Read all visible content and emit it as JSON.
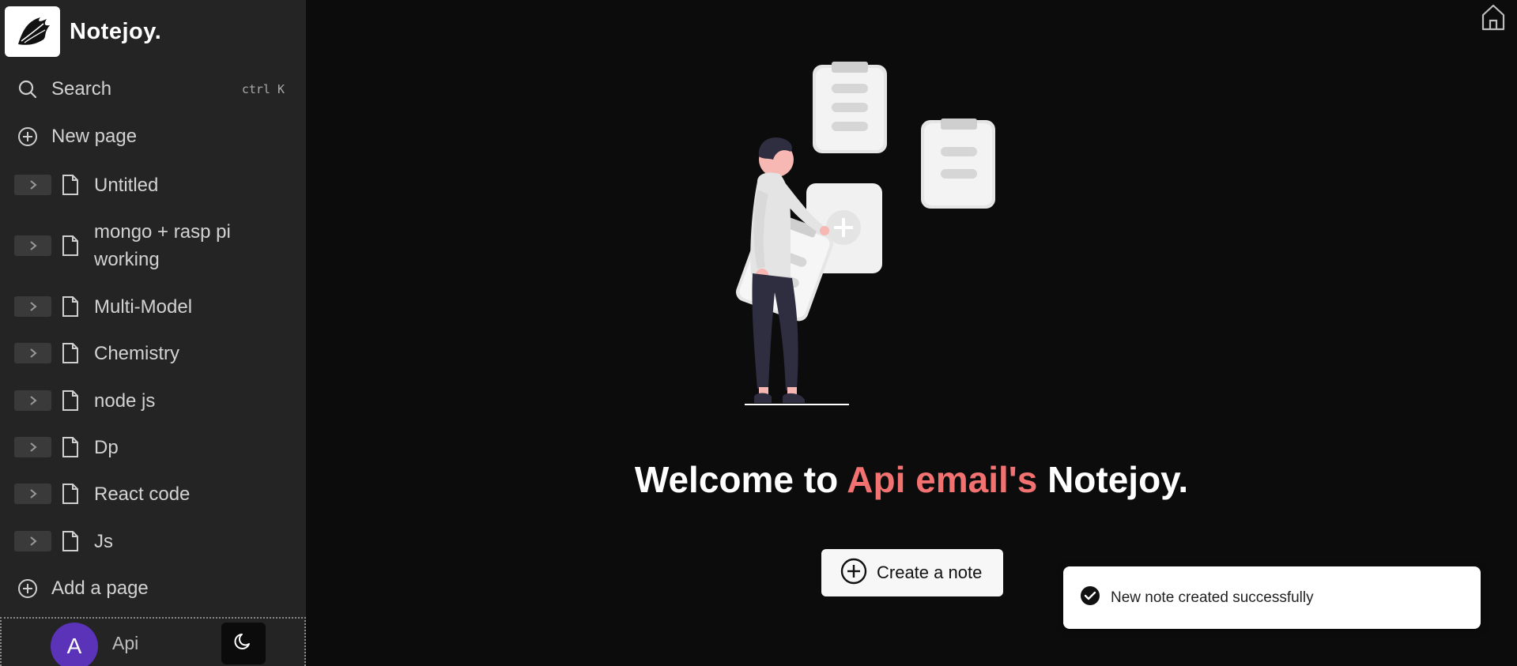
{
  "brand": {
    "name": "Notejoy."
  },
  "sidebar": {
    "search": {
      "label": "Search",
      "shortcut": "ctrl K"
    },
    "new_page": {
      "label": "New page"
    },
    "pages": [
      {
        "label": "Untitled"
      },
      {
        "label": "mongo + rasp pi working"
      },
      {
        "label": "Multi-Model"
      },
      {
        "label": "Chemistry"
      },
      {
        "label": "node js"
      },
      {
        "label": "Dp"
      },
      {
        "label": "React code"
      },
      {
        "label": "Js"
      }
    ],
    "add_page": {
      "label": "Add a page"
    },
    "user": {
      "initial": "A",
      "name": "Api"
    }
  },
  "main": {
    "welcome": {
      "prefix": "Welcome to ",
      "highlight": "Api email's",
      "suffix": " Notejoy."
    },
    "create_button": {
      "label": "Create a note"
    }
  },
  "toast": {
    "message": "New note created successfully"
  },
  "colors": {
    "sidebar_bg": "#242424",
    "main_bg": "#0c0c0c",
    "accent": "#f27171",
    "avatar": "#5a33b8"
  },
  "icons": [
    "logo-brush",
    "search-icon",
    "plus-circle-icon",
    "chevron-right-icon",
    "file-icon",
    "moon-icon",
    "home-icon",
    "check-circle-icon"
  ]
}
